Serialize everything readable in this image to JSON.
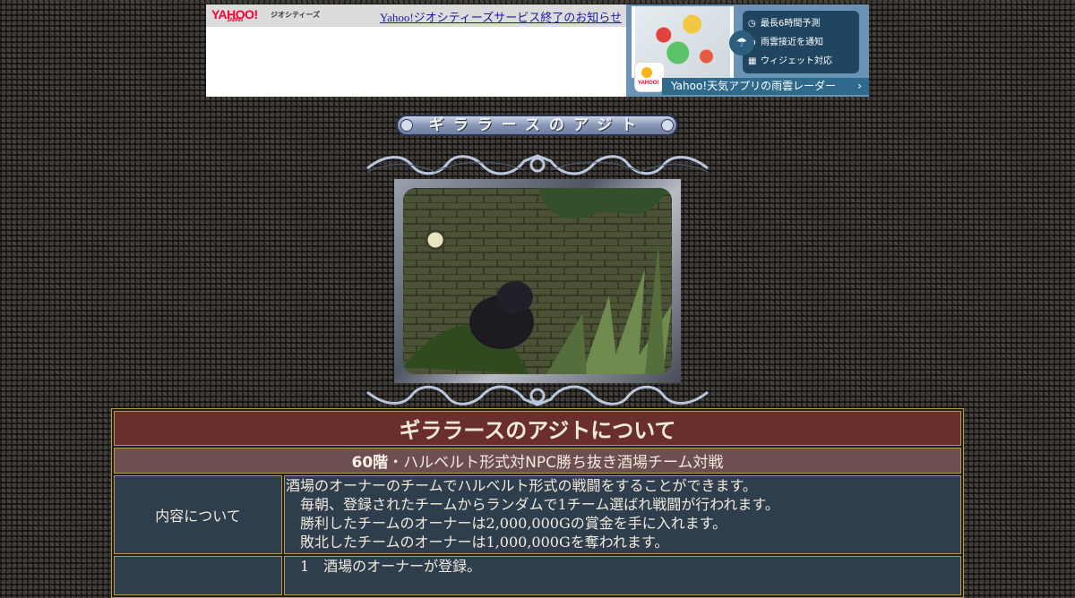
{
  "banner": {
    "yahoo_logo": "YAHOO!",
    "yahoo_logo_sub": "JAPAN",
    "service_name": "ジオシティーズ",
    "notice_link": "Yahoo!ジオシティーズサービス終了のお知らせ"
  },
  "ad": {
    "features": [
      {
        "icon": "clock-icon",
        "label": "最長6時間予測"
      },
      {
        "icon": "location-pin-icon",
        "label": "雨雲接近を通知"
      },
      {
        "icon": "widget-icon",
        "label": "ウィジェット対応"
      }
    ],
    "footer": "Yahoo!天気アプリの雨雲レーダー",
    "footer_chevron": "›"
  },
  "page": {
    "title": "ギララースのアジト"
  },
  "info": {
    "heading": "ギララースのアジトについて",
    "floor": "60階",
    "subheading_rest": "・ハルベルト形式対NPC勝ち抜き酒場チーム対戦",
    "rows": [
      {
        "label": "内容について",
        "lines": [
          "酒場のオーナーのチームでハルベルト形式の戦闘をすることができます。",
          "毎朝、登録されたチームからランダムで1チーム選ばれ戦闘が行われます。",
          "勝利したチームのオーナーは2,000,000Gの賞金を手に入れます。",
          "敗北したチームのオーナーは1,000,000Gを奪われます。"
        ]
      },
      {
        "label": "",
        "lines": [
          "1　酒場のオーナーが登録。"
        ]
      }
    ]
  }
}
